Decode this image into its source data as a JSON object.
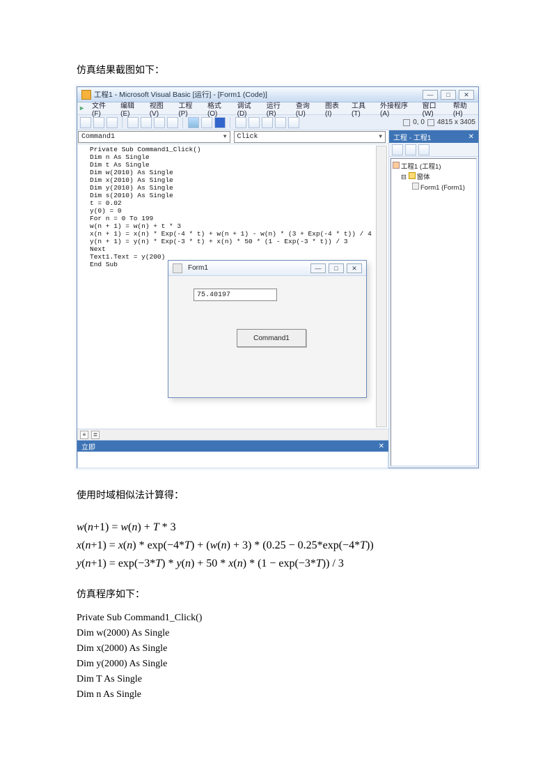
{
  "caption_top": "仿真结果截图如下：",
  "ide": {
    "title": "工程1 - Microsoft Visual Basic [运行] - [Form1 (Code)]",
    "win_buttons": {
      "min": "—",
      "max": "□",
      "close": "✕"
    },
    "menubar": [
      "文件(F)",
      "编辑(E)",
      "视图(V)",
      "工程(P)",
      "格式(O)",
      "调试(D)",
      "运行(R)",
      "查询(U)",
      "图表(I)",
      "工具(T)",
      "外接程序(A)",
      "窗口(W)",
      "帮助(H)"
    ],
    "coords_left": "0, 0",
    "coords_right": "4815 x 3405",
    "combo_left": "Command1",
    "combo_right": "Click",
    "code_lines": "Private Sub Command1_Click()\nDim n As Single\nDim t As Single\nDim w(2010) As Single\nDim x(2010) As Single\nDim y(2010) As Single\nDim s(2010) As Single\nt = 0.02\ny(0) = 0\nFor n = 0 To 199\nw(n + 1) = w(n) + t * 3\nx(n + 1) = x(n) * Exp(-4 * t) + w(n + 1) - w(n) * (3 + Exp(-4 * t)) / 4\ny(n + 1) = y(n) * Exp(-3 * t) + x(n) * 50 * (1 - Exp(-3 * t)) / 3\nNext\nText1.Text = y(200)\nEnd Sub",
    "form1": {
      "title": "Form1",
      "field_value": "75.40197",
      "button": "Command1"
    },
    "immediate_title": "立即",
    "project_pane": {
      "title": "工程 - 工程1",
      "root": "工程1 (工程1)",
      "folder": "窗体",
      "item": "Form1 (Form1)"
    }
  },
  "caption_mid": "使用时域相似法计算得：",
  "equations": {
    "l1": "w(n+1) = w(n) + T * 3",
    "l2": "x(n+1) = x(n) * exp(−4*T) + (w(n)+3) * (0.25 − 0.25*exp(−4*T))",
    "l3": "y(n+1) = exp(−3*T) * y(n) + 50 * x(n) * (1 − exp(−3*T)) / 3"
  },
  "caption_code": "仿真程序如下：",
  "listing": "Private Sub Command1_Click()\nDim w(2000) As Single\nDim x(2000) As Single\nDim y(2000) As Single\nDim T As Single\nDim n As Single"
}
